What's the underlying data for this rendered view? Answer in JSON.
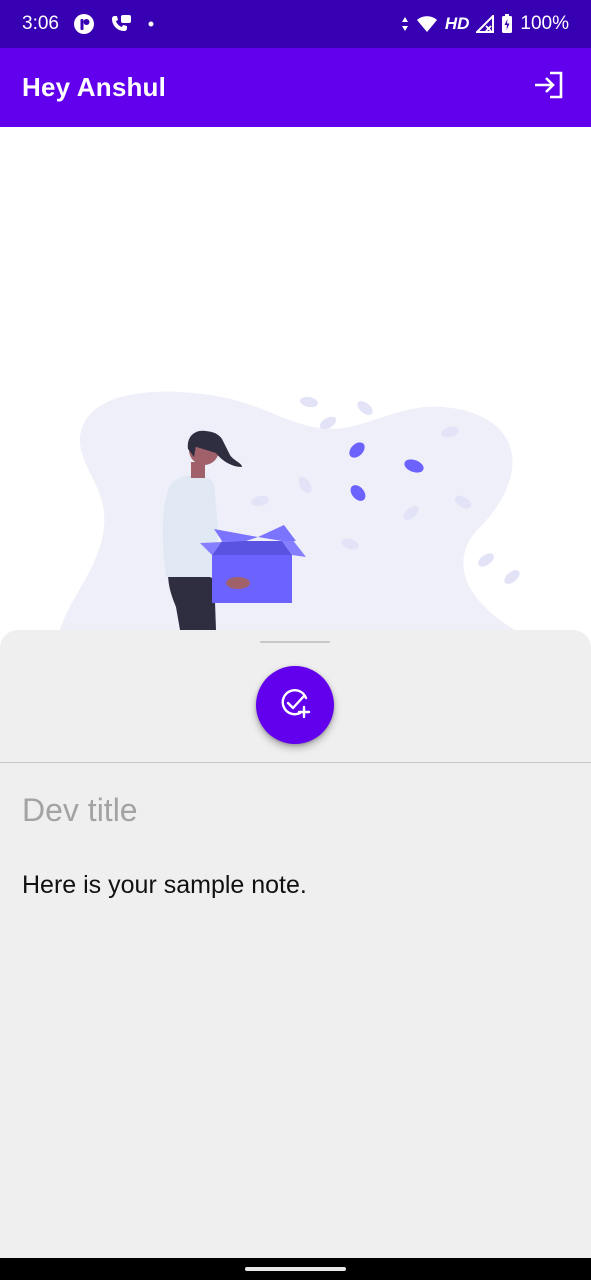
{
  "status_bar": {
    "time": "3:06",
    "network_label": "HD",
    "battery_label": "100%",
    "left_icons": [
      "photo-app-icon",
      "missed-call-icon",
      "dot-icon"
    ],
    "right_icons": [
      "data-arrows-icon",
      "wifi-icon",
      "signal-icon",
      "battery-icon"
    ]
  },
  "app_bar": {
    "title": "Hey Anshul",
    "action_icon": "logout-icon",
    "color": "#6200ee"
  },
  "illustration": {
    "icon": "empty-box-illustration",
    "accent_color": "#6c63ff"
  },
  "sheet": {
    "fab_icon": "add-check-icon",
    "title_placeholder": "Dev title",
    "note_text": "Here is your sample note."
  }
}
